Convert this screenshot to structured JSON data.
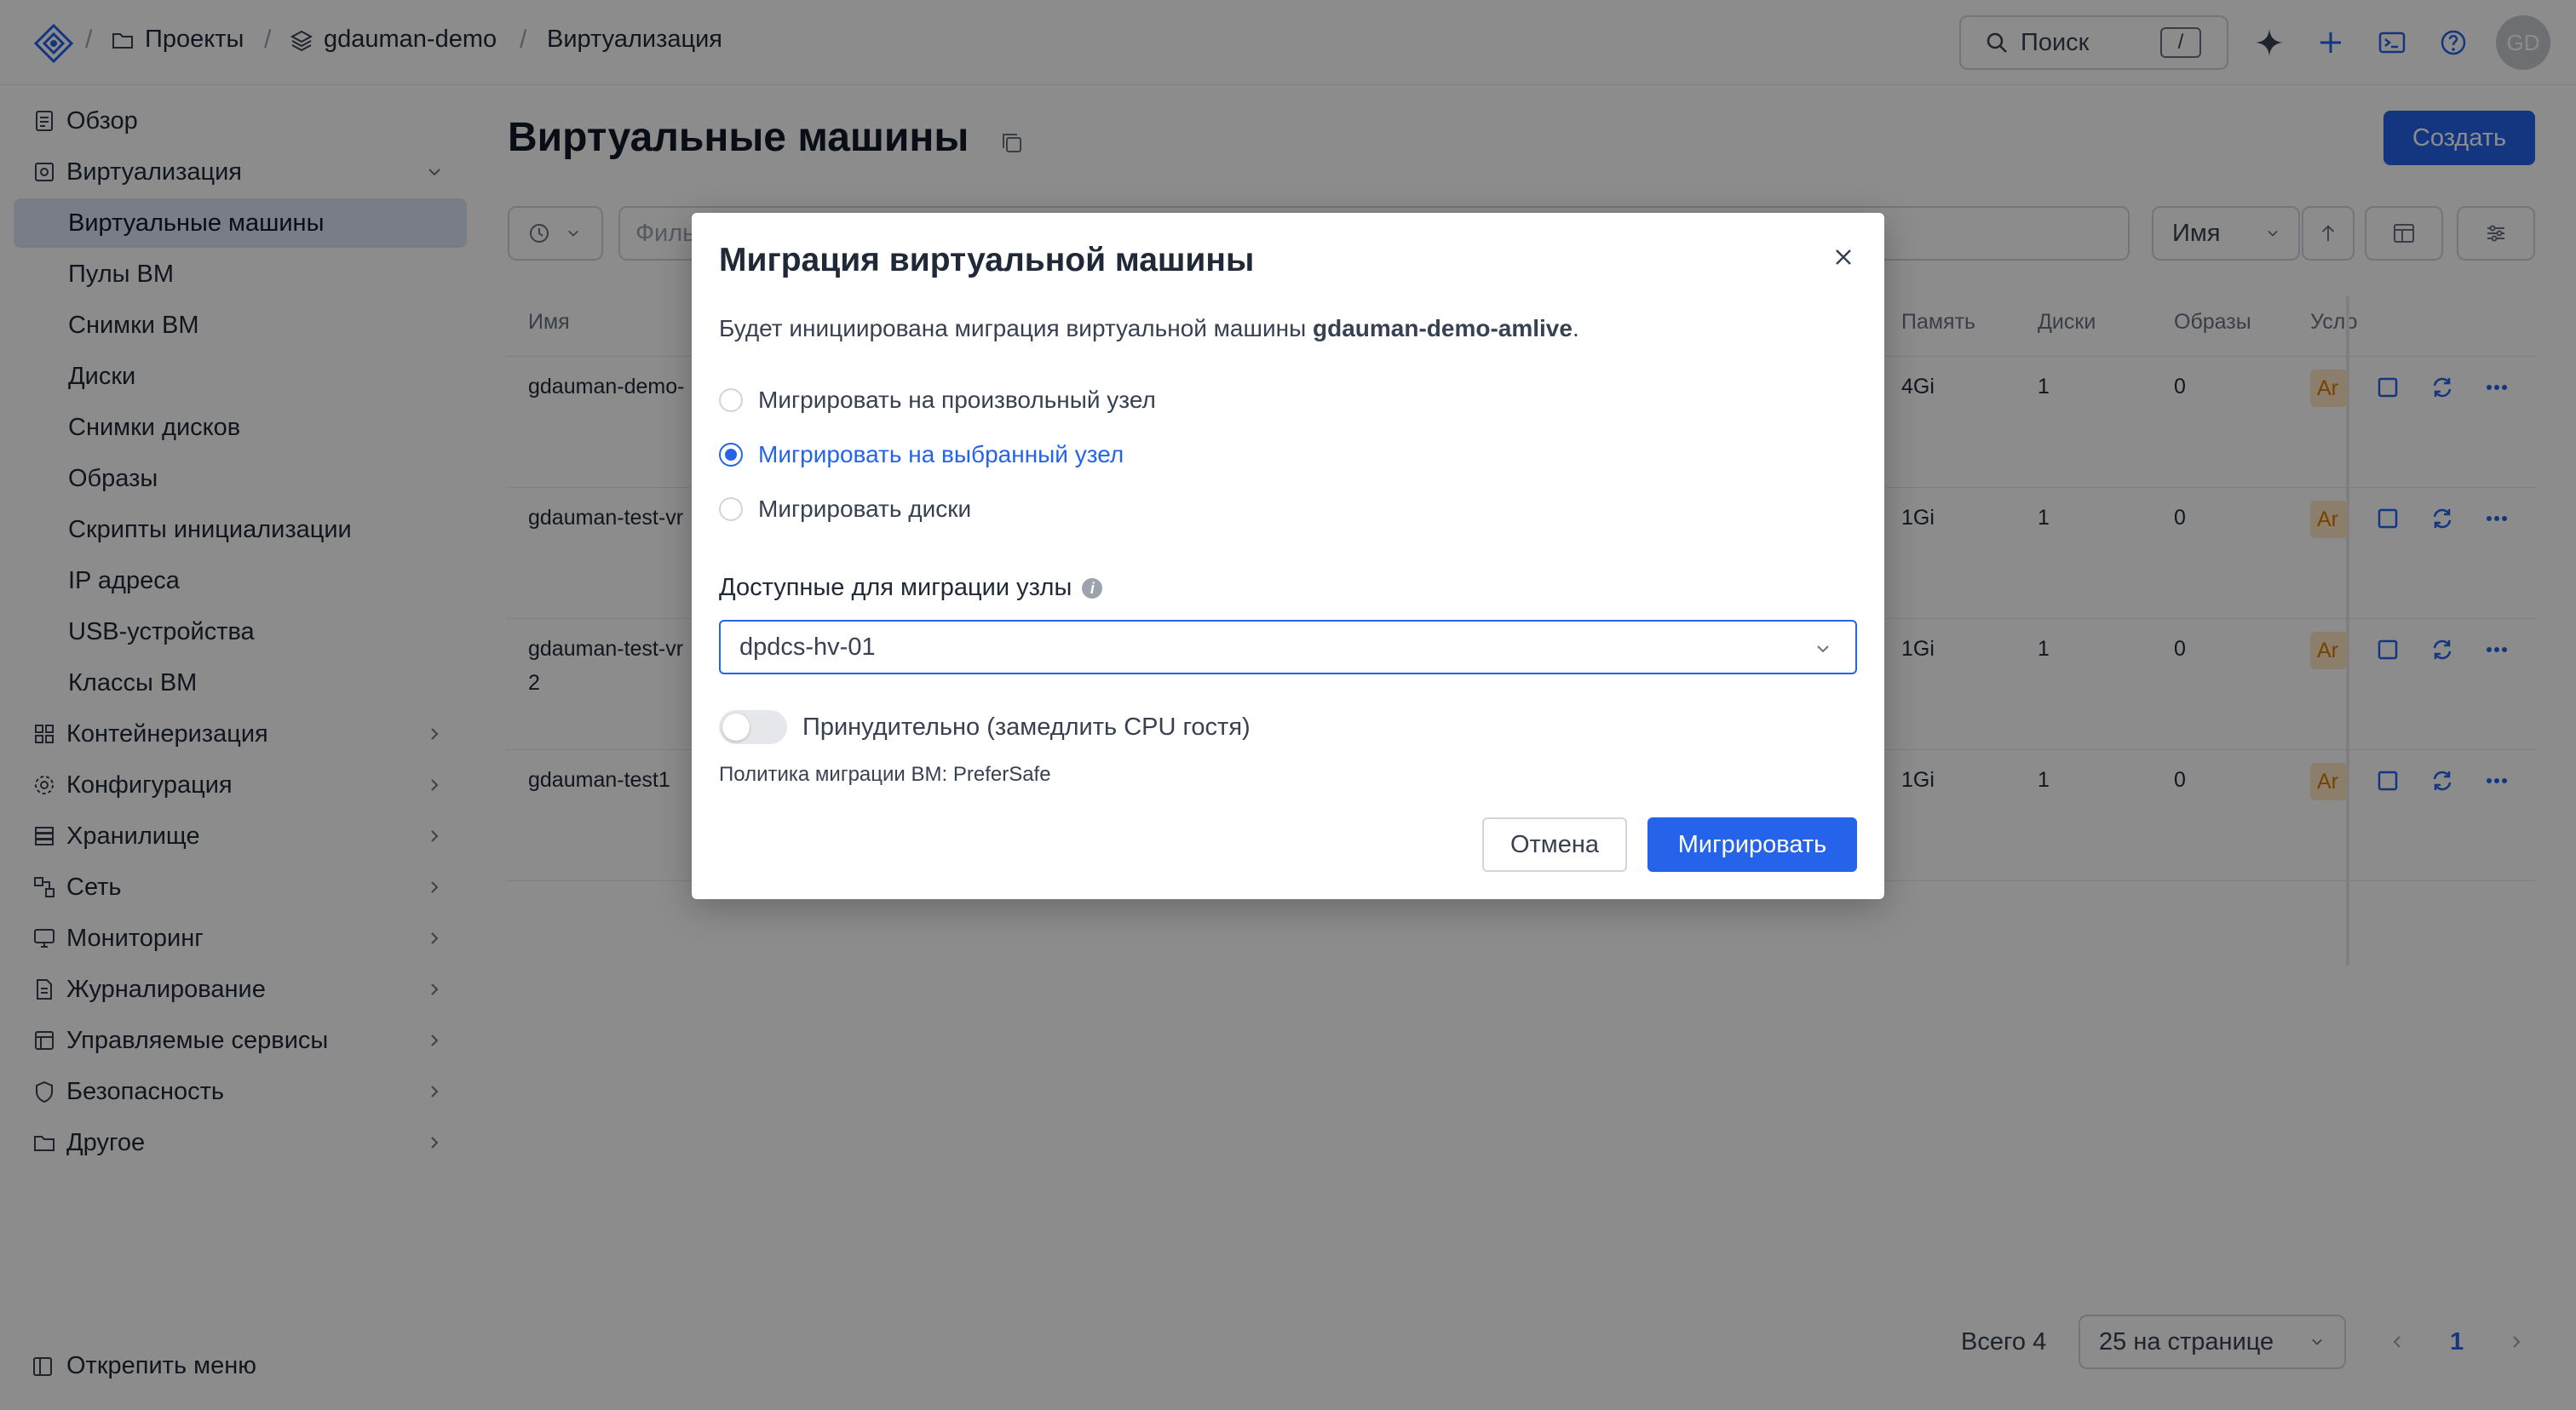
{
  "breadcrumb": {
    "projects": "Проекты",
    "project": "gdauman-demo",
    "section": "Виртуализация"
  },
  "topbar": {
    "search_label": "Поиск",
    "search_shortcut": "/",
    "avatar_initials": "GD",
    "icons": [
      "sparkle-icon",
      "plus-icon",
      "terminal-icon",
      "help-icon"
    ]
  },
  "sidebar": {
    "overview": "Обзор",
    "virtualization": "Виртуализация",
    "sub_items": [
      "Виртуальные машины",
      "Пулы ВМ",
      "Снимки ВМ",
      "Диски",
      "Снимки дисков",
      "Образы",
      "Скрипты инициализации",
      "IP адреса",
      "USB-устройства",
      "Классы ВМ"
    ],
    "groups": [
      "Контейнеризация",
      "Конфигурация",
      "Хранилище",
      "Сеть",
      "Мониторинг",
      "Журналирование",
      "Управляемые сервисы",
      "Безопасность",
      "Другое"
    ],
    "unpin": "Открепить меню"
  },
  "main": {
    "title": "Виртуальные машины",
    "create_button": "Создать",
    "filter_placeholder": "Филь",
    "sort_label": "Имя",
    "columns": {
      "name": "Имя",
      "memory": "Память",
      "disks": "Диски",
      "images": "Образы",
      "conditions": "Усло"
    },
    "rows": [
      {
        "name": "gdauman-demo-",
        "name2": "",
        "memory": "4Gi",
        "disks": "1",
        "images": "0",
        "badge": "Ar"
      },
      {
        "name": "gdauman-test-vr",
        "name2": "",
        "memory": "1Gi",
        "disks": "1",
        "images": "0",
        "badge": "Ar"
      },
      {
        "name": "gdauman-test-vr",
        "name2": "2",
        "memory": "1Gi",
        "disks": "1",
        "images": "0",
        "badge": "Ar"
      },
      {
        "name": "gdauman-test1",
        "name2": "",
        "memory": "1Gi",
        "disks": "1",
        "images": "0",
        "badge": "Ar"
      }
    ],
    "total": "Всего 4",
    "per_page": "25 на странице",
    "current_page": "1"
  },
  "modal": {
    "title": "Миграция виртуальной машины",
    "desc_prefix": "Будет инициирована миграция виртуальной машины ",
    "vm_name": "gdauman-demo-amlive",
    "desc_suffix": ".",
    "options": [
      "Мигрировать на произвольный узел",
      "Мигрировать на выбранный узел",
      "Мигрировать диски"
    ],
    "selected_option": 1,
    "nodes_label": "Доступные для миграции узлы",
    "node_value": "dpdcs-hv-01",
    "force_label": "Принудительно (замедлить CPU гостя)",
    "policy": "Политика миграции ВМ: PreferSafe",
    "cancel": "Отмена",
    "migrate": "Мигрировать"
  },
  "colors": {
    "accent": "#2563eb",
    "active_nav": "#dbe4f7",
    "badge_bg": "#fde7c4",
    "badge_text": "#d97706"
  }
}
